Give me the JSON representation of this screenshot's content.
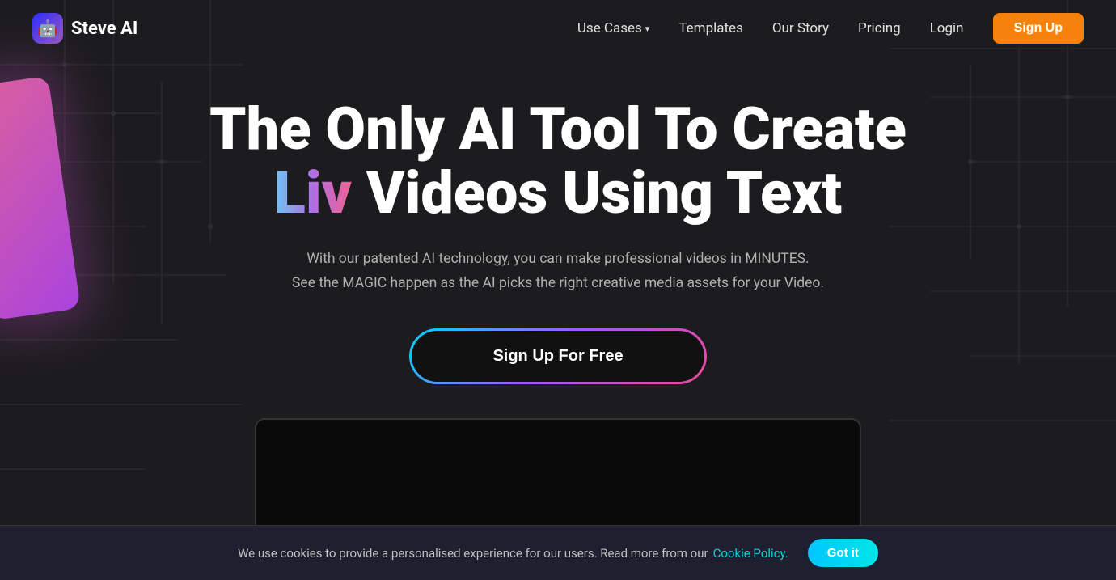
{
  "meta": {
    "title": "Steve AI - The Only AI Tool To Create Live Videos Using Text"
  },
  "colors": {
    "accent_orange": "#f5820d",
    "accent_gradient_start": "#00d4ff",
    "accent_gradient_end": "#a855f7",
    "background": "#1c1c1e",
    "cookie_link": "#00d4d4"
  },
  "logo": {
    "text": "Steve AI",
    "icon_emoji": "🤖"
  },
  "navbar": {
    "links": [
      {
        "label": "Use Cases",
        "has_arrow": true
      },
      {
        "label": "Templates",
        "has_arrow": false
      },
      {
        "label": "Our Story",
        "has_arrow": false
      },
      {
        "label": "Pricing",
        "has_arrow": false
      }
    ],
    "login_label": "Login",
    "signup_label": "Sign Up"
  },
  "hero": {
    "title_line1": "The Only AI Tool To Create",
    "title_liv": "Liv",
    "title_line2": " Videos Using Text",
    "subtitle_line1": "With our patented AI technology, you can make professional videos in MINUTES.",
    "subtitle_line2": "See the MAGIC happen as the AI picks the right creative media assets for your Video.",
    "cta_label": "Sign Up For Free"
  },
  "cookie_bar": {
    "message": "We use cookies to provide a personalised experience for our users. Read more from our",
    "link_text": "Cookie Policy.",
    "button_label": "Got it"
  }
}
